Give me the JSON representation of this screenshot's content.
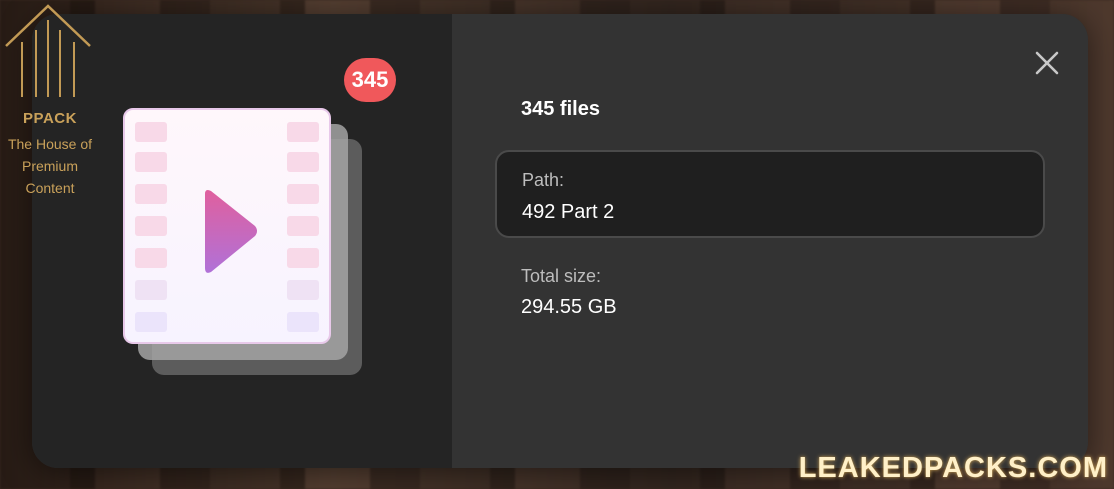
{
  "logo": {
    "title": "PPACK",
    "subtitle_lines": [
      "The House of",
      "Premium",
      "Content"
    ]
  },
  "modal": {
    "badge_count": "345",
    "files_count": "345 files",
    "path": {
      "label": "Path:",
      "value": "492 Part 2"
    },
    "total_size": {
      "label": "Total size:",
      "value": "294.55 GB"
    },
    "close_icon": "close-icon",
    "folder_icon": "video-stack-icon"
  },
  "watermark": "LEAKEDPACKS.COM",
  "colors": {
    "badge": "#f0585b",
    "play": "#cc66cc",
    "logo_gold": "#c9a15a"
  }
}
